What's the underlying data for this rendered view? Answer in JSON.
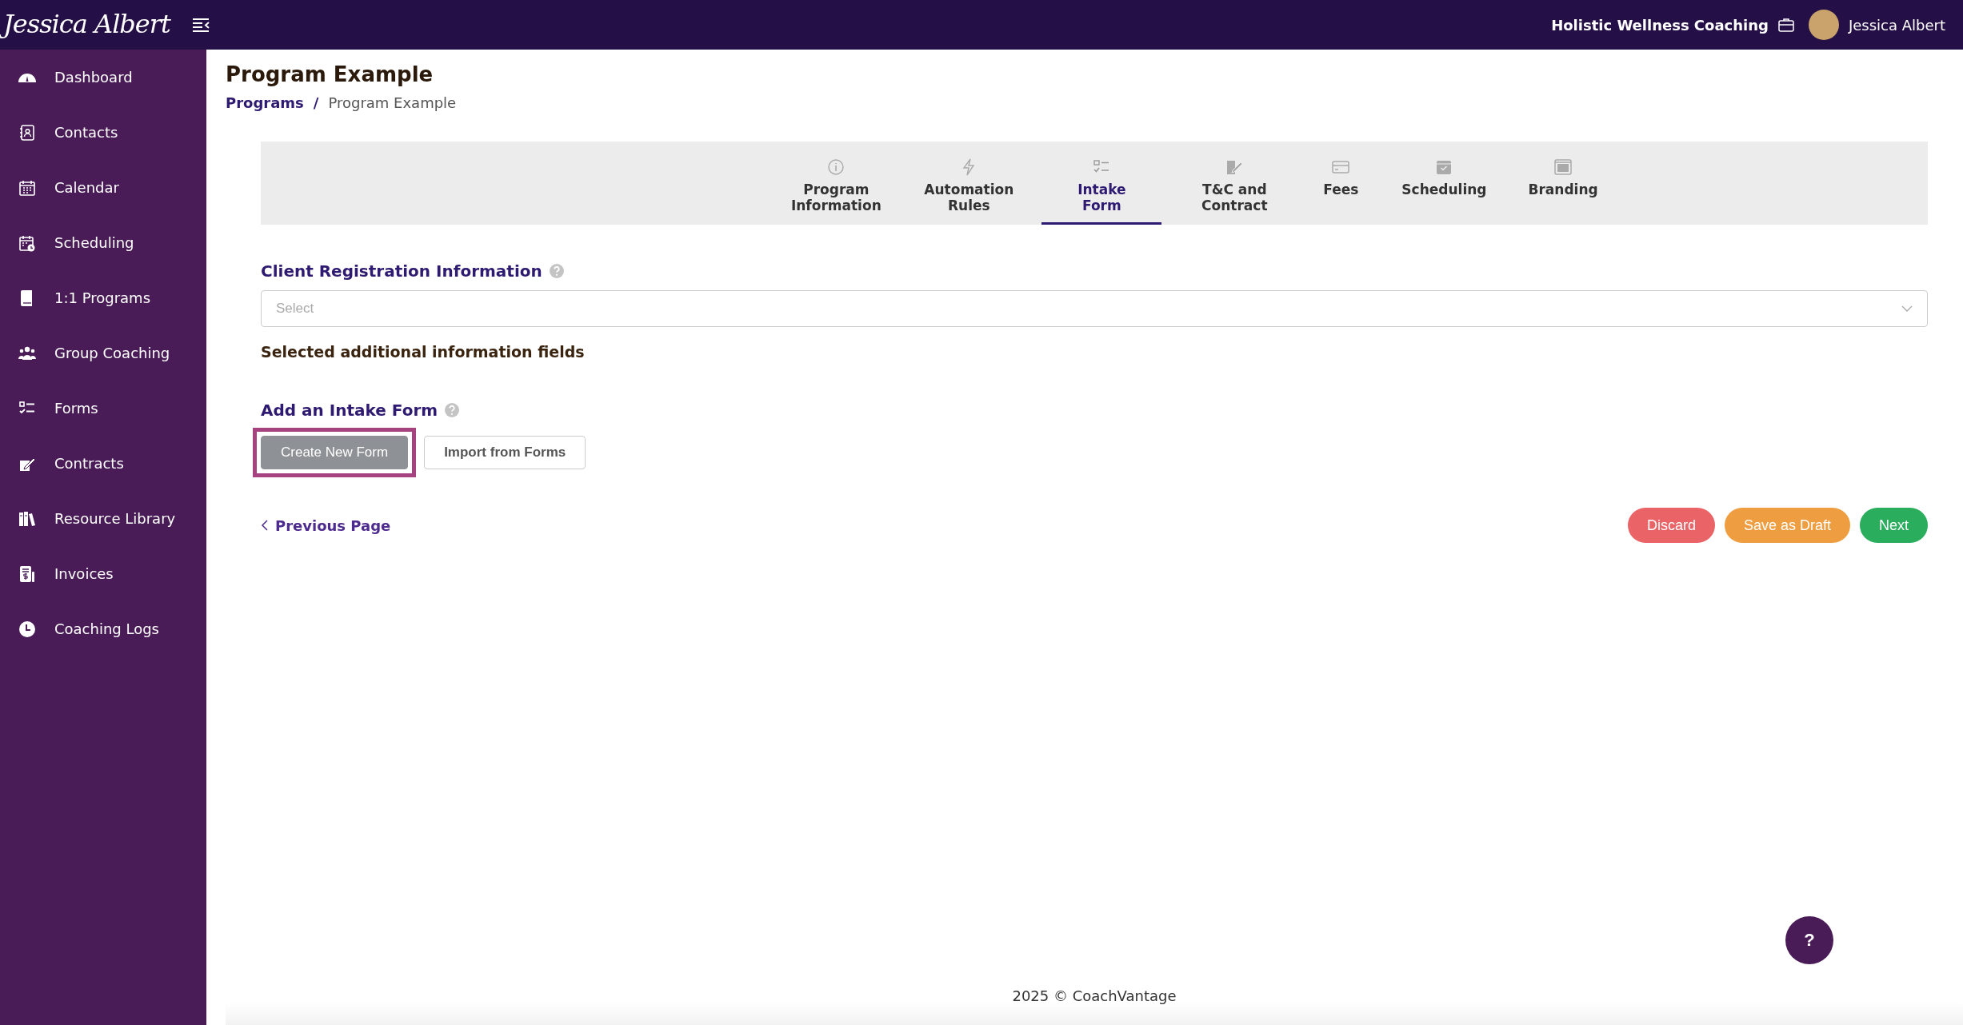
{
  "header": {
    "logo": "Jessica Albert",
    "business": "Holistic Wellness Coaching",
    "user": "Jessica Albert"
  },
  "sidebar": {
    "items": [
      {
        "label": "Dashboard"
      },
      {
        "label": "Contacts"
      },
      {
        "label": "Calendar"
      },
      {
        "label": "Scheduling"
      },
      {
        "label": "1:1 Programs"
      },
      {
        "label": "Group Coaching"
      },
      {
        "label": "Forms"
      },
      {
        "label": "Contracts"
      },
      {
        "label": "Resource Library"
      },
      {
        "label": "Invoices"
      },
      {
        "label": "Coaching Logs"
      }
    ]
  },
  "page": {
    "title": "Program Example",
    "breadcrumbs": [
      {
        "label": "Programs",
        "link": true
      },
      {
        "label": "Program Example",
        "link": false
      }
    ],
    "breadcrumb_separator": "/"
  },
  "tabs": [
    {
      "label": "Program Information",
      "selected": false
    },
    {
      "label": "Automation Rules",
      "selected": false
    },
    {
      "label": "Intake Form",
      "selected": true
    },
    {
      "label": "T&C and Contract",
      "selected": false
    },
    {
      "label": "Fees",
      "selected": false
    },
    {
      "label": "Scheduling",
      "selected": false
    },
    {
      "label": "Branding",
      "selected": false
    }
  ],
  "registration": {
    "heading": "Client Registration Information",
    "select_placeholder": "Select",
    "subheading": "Selected additional information fields"
  },
  "intake": {
    "heading": "Add an Intake Form",
    "buttons": [
      {
        "label": "Create New Form",
        "kind": "filled",
        "highlighted": true
      },
      {
        "label": "Import from Forms",
        "kind": "outline",
        "highlighted": false
      }
    ]
  },
  "previous_link": "Previous Page",
  "actions": [
    {
      "label": "Discard",
      "kind": "danger"
    },
    {
      "label": "Save as Draft",
      "kind": "warning"
    },
    {
      "label": "Next",
      "kind": "success"
    }
  ],
  "help_button": "?",
  "footer": "2025 © CoachVantage"
}
